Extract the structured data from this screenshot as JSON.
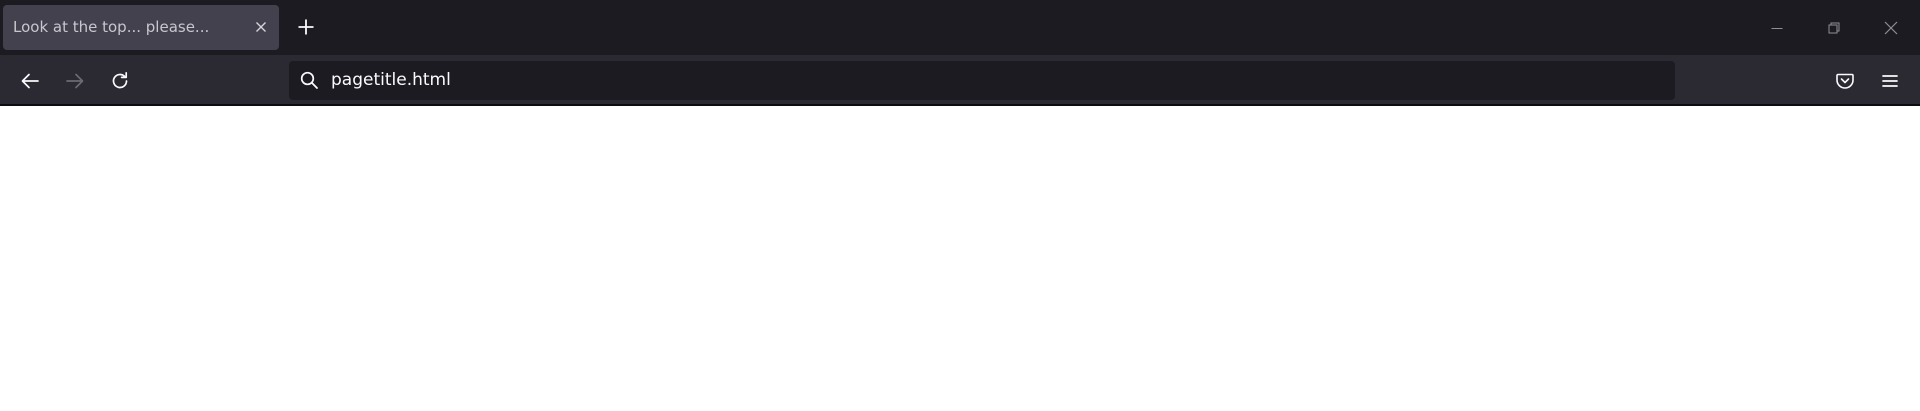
{
  "tabs": [
    {
      "title": "Look at the top... please..."
    }
  ],
  "urlbar": {
    "value": "pagetitle.html"
  },
  "icons": {
    "tab_close": "close-icon",
    "new_tab": "plus-icon",
    "minimize": "minimize-icon",
    "restore": "restore-icon",
    "close_window": "close-icon",
    "back": "back-arrow-icon",
    "forward": "forward-arrow-icon",
    "reload": "reload-icon",
    "search": "search-icon",
    "pocket": "pocket-icon",
    "menu": "hamburger-menu-icon"
  },
  "colors": {
    "tabbar_bg": "#1c1b22",
    "active_tab_bg": "#42414d",
    "toolbar_bg": "#2b2a33",
    "urlbar_bg": "#1c1b22",
    "text": "#fbfbfe",
    "page_bg": "#ffffff"
  }
}
